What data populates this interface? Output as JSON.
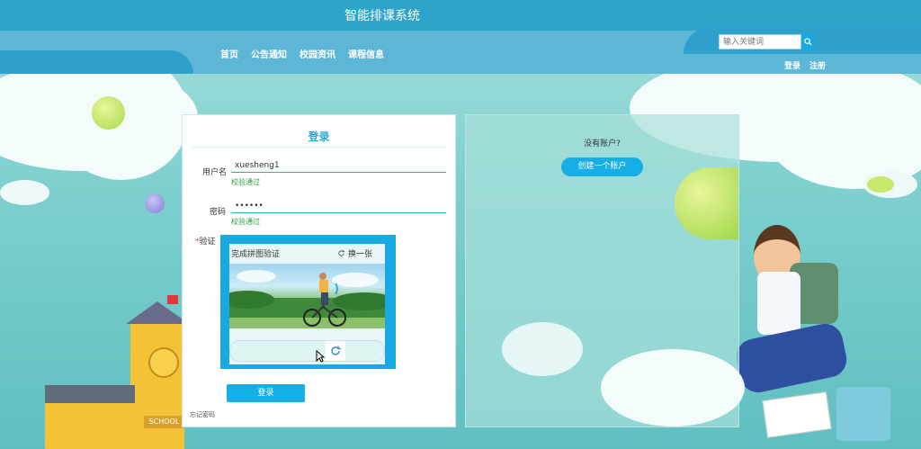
{
  "header": {
    "site_title": "智能排课系统",
    "nav": [
      "首页",
      "公告通知",
      "校园资讯",
      "课程信息"
    ],
    "search_placeholder": "输入关键词",
    "login_link": "登录",
    "register_link": "注册"
  },
  "login": {
    "title": "登录",
    "username_label": "用户名",
    "username_value": "xuesheng1",
    "username_status": "校验通过",
    "password_label": "密码",
    "password_value": "••••••",
    "password_status": "校验通过",
    "captcha_label": "验证",
    "submit_label": "登录",
    "forgot_label": "忘记密码"
  },
  "captcha": {
    "title": "完成拼图验证",
    "refresh_label": "换一张"
  },
  "register_panel": {
    "prompt": "没有账户?",
    "create_label": "创建一个账户"
  }
}
